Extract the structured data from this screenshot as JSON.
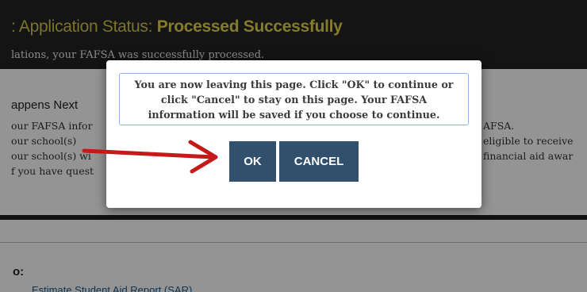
{
  "page": {
    "status_label": ": Application Status: ",
    "status_value": "Processed Successfully",
    "status_message": "lations, your FAFSA was successfully processed.",
    "next_heading": "appens Next",
    "info_lines": [
      "our FAFSA infor",
      "our school(s) ",
      "our school(s) wi",
      "f you have quest"
    ],
    "info_right": [
      "AFSA.",
      "eligible to receive",
      "financial aid awar"
    ],
    "also_heading": "o:",
    "bottom_link": "Estimate Student Aid Report (SAR)"
  },
  "modal": {
    "message": "You are now leaving this page. Click \"OK\" to continue or click \"Cancel\" to stay on this page. Your FAFSA information will be saved if you choose to continue.",
    "ok_label": "OK",
    "cancel_label": "CANCEL"
  },
  "colors": {
    "status_band": "#232323",
    "status_title": "#d4c44a",
    "button": "#30506e",
    "arrow": "#c41a1a",
    "message_border": "#8fb4e6"
  }
}
